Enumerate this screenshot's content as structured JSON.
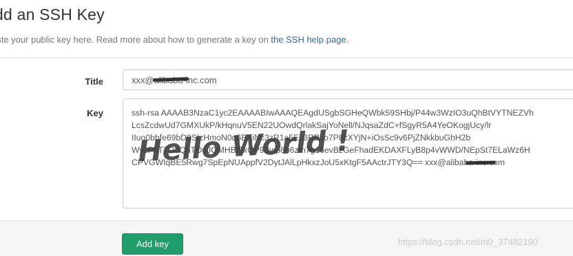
{
  "page": {
    "title": "dd an SSH Key",
    "subtitle_text": "aste your public key here. Read more about how to generate a key on ",
    "subtitle_link": "the SSH help page",
    "subtitle_end": "."
  },
  "form": {
    "title_label": "Title",
    "title_value": "xxx@alibaba-inc.com",
    "key_label": "Key",
    "key_lines": [
      "ssh-rsa AAAAB3NzaC1yc2EAAAABIwAAAQEAgdUSgbSGHeQWbk59SHbj/P44w3WzIO3uQhBtVYTNEZVh",
      "LcsZcdwUd7GMXUkP/kHqnuV5EN22UOwdQrlakSajYoNell/NJqsaZdC+fSgyR5A4YeOKogjUcy/lr",
      "IIuo0bbfe69bD8SIzHmoN0q6BXiNc3zR1a5Ec3RBxo7P8cXYjN+iOsSc9v6PjZNkkbuGhH2b",
      "WyzPhTTOoQhTOuJQMHBf9xQP9Swp8o6zm7g16evBzGeFhadEKDAXFLyB8p4vWWD/NEpSt7ELaWz6H",
      "CPVGWIqBE5Rwg7SpEpNUAppfV2DytJAlLpHkxzJoU5xKtgF5AActrJTY3Q== xxx@alibaba-inc.com"
    ]
  },
  "actions": {
    "add_key_label": "Add key"
  },
  "overlay": {
    "handwriting_text": "Hello World !",
    "watermark": "https://blog.csdn.net/m0_37482190"
  },
  "colors": {
    "accent": "#1f9d6a",
    "link": "#2e6ba4"
  }
}
